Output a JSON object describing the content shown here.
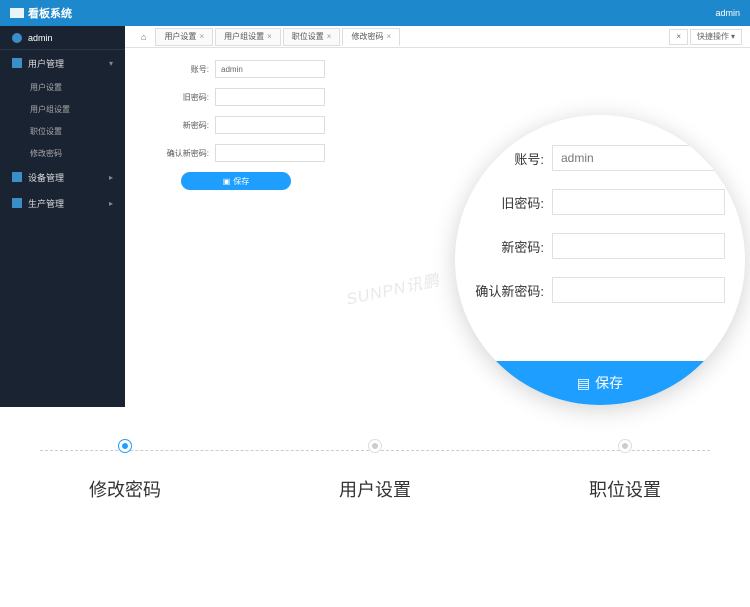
{
  "header": {
    "app_title": "看板系统",
    "user": "admin"
  },
  "sidebar": {
    "user": "admin",
    "menu": [
      {
        "label": "用户管理",
        "type": "parent",
        "expanded": true
      },
      {
        "label": "用户设置",
        "type": "sub"
      },
      {
        "label": "用户组设置",
        "type": "sub"
      },
      {
        "label": "职位设置",
        "type": "sub"
      },
      {
        "label": "修改密码",
        "type": "sub"
      },
      {
        "label": "设备管理",
        "type": "parent",
        "expanded": false
      },
      {
        "label": "生产管理",
        "type": "parent",
        "expanded": false
      }
    ]
  },
  "tabs": {
    "home_icon": "⌂",
    "items": [
      {
        "label": "用户设置",
        "active": false
      },
      {
        "label": "用户组设置",
        "active": false
      },
      {
        "label": "职位设置",
        "active": false
      },
      {
        "label": "修改密码",
        "active": true
      }
    ],
    "quick_label": "快捷操作",
    "close_label": "×"
  },
  "form": {
    "fields": [
      {
        "label": "账号:",
        "value": "admin",
        "type": "text"
      },
      {
        "label": "旧密码:",
        "value": "",
        "type": "password"
      },
      {
        "label": "新密码:",
        "value": "",
        "type": "password"
      },
      {
        "label": "确认新密码:",
        "value": "",
        "type": "password"
      }
    ],
    "save_label": "保存",
    "save_icon": "▣"
  },
  "zoom": {
    "fields": [
      {
        "label": "账号:",
        "value": "admin"
      },
      {
        "label": "旧密码:",
        "value": ""
      },
      {
        "label": "新密码:",
        "value": ""
      },
      {
        "label": "确认新密码:",
        "value": ""
      }
    ],
    "save_label": "保存",
    "save_icon": "▤"
  },
  "watermark": "SUNPN讯鹏",
  "stepper": {
    "items": [
      {
        "label": "修改密码",
        "active": true
      },
      {
        "label": "用户设置",
        "active": false
      },
      {
        "label": "职位设置",
        "active": false
      }
    ]
  }
}
